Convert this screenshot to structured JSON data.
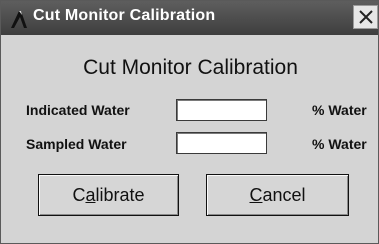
{
  "window": {
    "title": "Cut Monitor Calibration",
    "icon": "antenna-icon"
  },
  "dialog": {
    "heading": "Cut Monitor Calibration",
    "fields": [
      {
        "label": "Indicated Water",
        "value": "",
        "unit": "% Water"
      },
      {
        "label": "Sampled Water",
        "value": "",
        "unit": "% Water"
      }
    ]
  },
  "buttons": {
    "calibrate": {
      "pre": "C",
      "accel": "a",
      "post": "librate"
    },
    "cancel": {
      "pre": "",
      "accel": "C",
      "post": "ancel"
    }
  },
  "colors": {
    "titlebar": "#4a4a4a",
    "window_bg": "#d4d4d4"
  }
}
